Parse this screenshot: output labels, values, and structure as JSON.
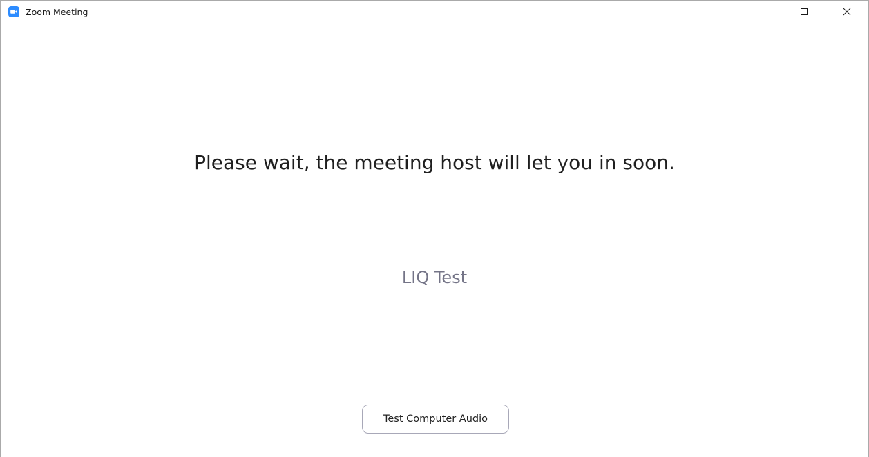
{
  "window": {
    "title": "Zoom Meeting",
    "app_icon": "zoom-camera-icon",
    "controls": [
      "minimize-icon",
      "maximize-icon",
      "close-icon"
    ]
  },
  "waiting_room": {
    "message": "Please wait, the meeting host will let you in soon.",
    "meeting_name": "LIQ Test",
    "audio_button_label": "Test Computer Audio"
  },
  "colors": {
    "zoom_blue": "#2D8CFF",
    "message_text": "#1F1F1F",
    "meeting_name_text": "#747487"
  }
}
